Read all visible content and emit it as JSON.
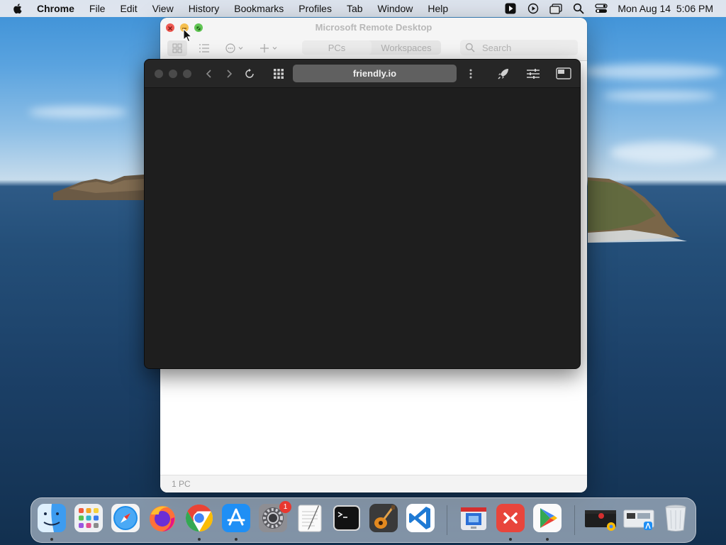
{
  "menubar": {
    "app_name": "Chrome",
    "menus": [
      "File",
      "Edit",
      "View",
      "History",
      "Bookmarks",
      "Profiles",
      "Tab",
      "Window",
      "Help"
    ],
    "clock": "Mon Aug 14  5:06 PM"
  },
  "rdp_window": {
    "title": "Microsoft Remote Desktop",
    "tabs": [
      "PCs",
      "Workspaces"
    ],
    "active_tab": "PCs",
    "search_placeholder": "Search",
    "footer_count": "1 PC"
  },
  "browser": {
    "url": "friendly.io"
  },
  "dock": {
    "items": [
      {
        "name": "Finder",
        "icon": "finder-icon"
      },
      {
        "name": "Launchpad",
        "icon": "launchpad-icon"
      },
      {
        "name": "Safari",
        "icon": "safari-icon"
      },
      {
        "name": "Firefox",
        "icon": "firefox-icon"
      },
      {
        "name": "Google Chrome",
        "icon": "chrome-icon"
      },
      {
        "name": "App Store",
        "icon": "app-store-icon"
      },
      {
        "name": "System Preferences",
        "icon": "system-preferences-icon",
        "badge": "1"
      },
      {
        "name": "TextEdit",
        "icon": "textedit-icon"
      },
      {
        "name": "Terminal",
        "icon": "terminal-icon"
      },
      {
        "name": "GarageBand",
        "icon": "garageband-icon"
      },
      {
        "name": "Visual Studio Code",
        "icon": "vscode-icon"
      },
      {
        "name": "Microsoft Remote Desktop",
        "icon": "remote-desktop-icon"
      },
      {
        "name": "Remote Access",
        "icon": "remote-access-icon"
      },
      {
        "name": "Google Play",
        "icon": "play-icon"
      },
      {
        "name": "Recent Window",
        "icon": "recent-window-icon"
      },
      {
        "name": "Applications",
        "icon": "applications-folder-icon"
      },
      {
        "name": "Trash",
        "icon": "trash-icon"
      }
    ]
  },
  "colors": {
    "close": "#ee5a52",
    "minimize": "#f5bf4f",
    "zoom": "#61c554",
    "browser_bg": "#1e1e1e",
    "urlbar_bg": "#606060"
  }
}
